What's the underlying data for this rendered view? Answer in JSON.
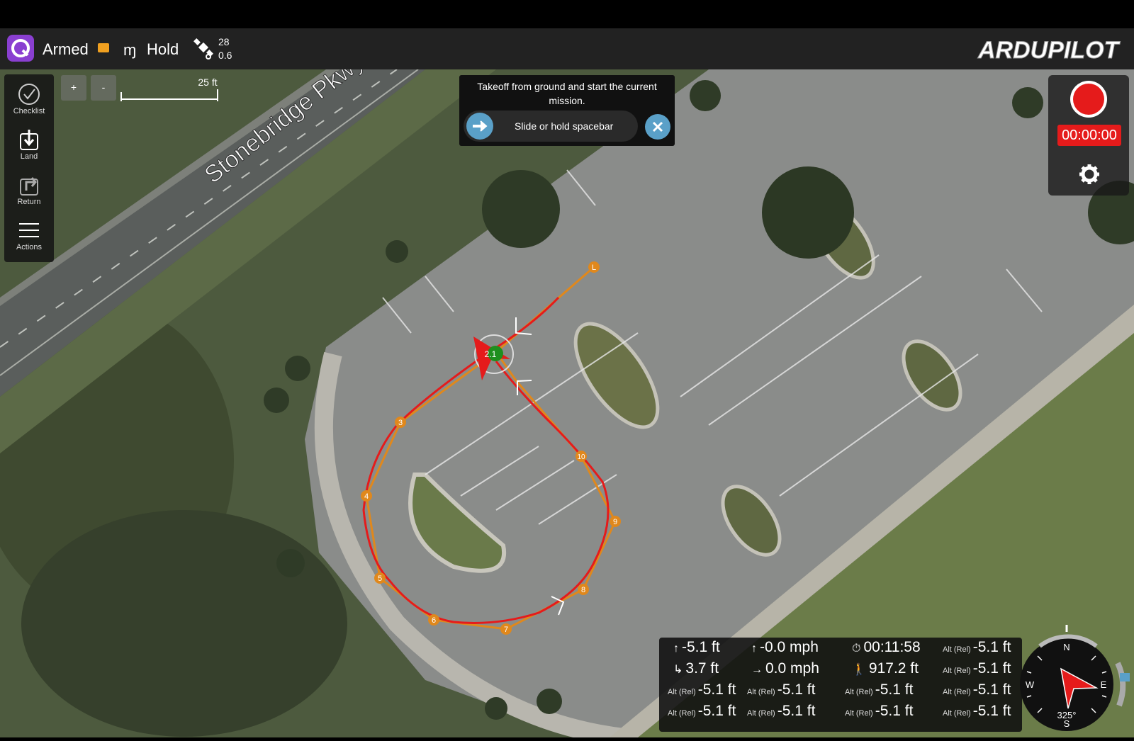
{
  "toolbar": {
    "status": "Armed",
    "flight_mode": "Hold",
    "satellites": "28",
    "hdop": "0.6",
    "brand": "ARDUPILOT"
  },
  "left_panel": [
    {
      "label": "Checklist",
      "icon": "check-circle-icon"
    },
    {
      "label": "Land",
      "icon": "land-icon"
    },
    {
      "label": "Return",
      "icon": "return-icon"
    },
    {
      "label": "Actions",
      "icon": "menu-icon"
    }
  ],
  "map": {
    "zoom_in": "+",
    "zoom_out": "-",
    "scale": "25 ft",
    "street": "Stonebridge Pkwy",
    "vehicle_label": "2.1",
    "waypoints": [
      "L",
      "3",
      "4",
      "5",
      "6",
      "7",
      "8",
      "9",
      "10"
    ]
  },
  "toast": {
    "message": "Takeoff from ground and start the current mission.",
    "slider_label": "Slide or hold spacebar"
  },
  "record": {
    "timer": "00:00:00"
  },
  "telemetry": {
    "rows": [
      [
        {
          "label": "",
          "icon": "↑",
          "value": "-5.1 ft"
        },
        {
          "label": "",
          "icon": "↑",
          "value": "-0.0 mph"
        },
        {
          "label": "",
          "icon": "⏱",
          "value": "00:11:58"
        },
        {
          "label": "Alt (Rel)",
          "icon": "",
          "value": "-5.1 ft"
        }
      ],
      [
        {
          "label": "",
          "icon": "↳",
          "value": "3.7 ft"
        },
        {
          "label": "",
          "icon": "→",
          "value": "0.0 mph"
        },
        {
          "label": "",
          "icon": "🚶",
          "value": "917.2 ft"
        },
        {
          "label": "Alt (Rel)",
          "icon": "",
          "value": "-5.1 ft"
        }
      ],
      [
        {
          "label": "Alt (Rel)",
          "icon": "",
          "value": "-5.1 ft"
        },
        {
          "label": "Alt (Rel)",
          "icon": "",
          "value": "-5.1 ft"
        },
        {
          "label": "Alt (Rel)",
          "icon": "",
          "value": "-5.1 ft"
        },
        {
          "label": "Alt (Rel)",
          "icon": "",
          "value": "-5.1 ft"
        }
      ],
      [
        {
          "label": "Alt (Rel)",
          "icon": "",
          "value": "-5.1 ft"
        },
        {
          "label": "Alt (Rel)",
          "icon": "",
          "value": "-5.1 ft"
        },
        {
          "label": "Alt (Rel)",
          "icon": "",
          "value": "-5.1 ft"
        },
        {
          "label": "Alt (Rel)",
          "icon": "",
          "value": "-5.1 ft"
        }
      ]
    ]
  },
  "compass": {
    "n": "N",
    "e": "E",
    "s": "S",
    "w": "W",
    "heading": "325°"
  },
  "colors": {
    "toolbar_accent": "#2ea02e",
    "track": "#e51b1b",
    "mission_path": "#e0881c",
    "record": "#e51b1b",
    "vehicle_marker": "#1e8f1e"
  }
}
